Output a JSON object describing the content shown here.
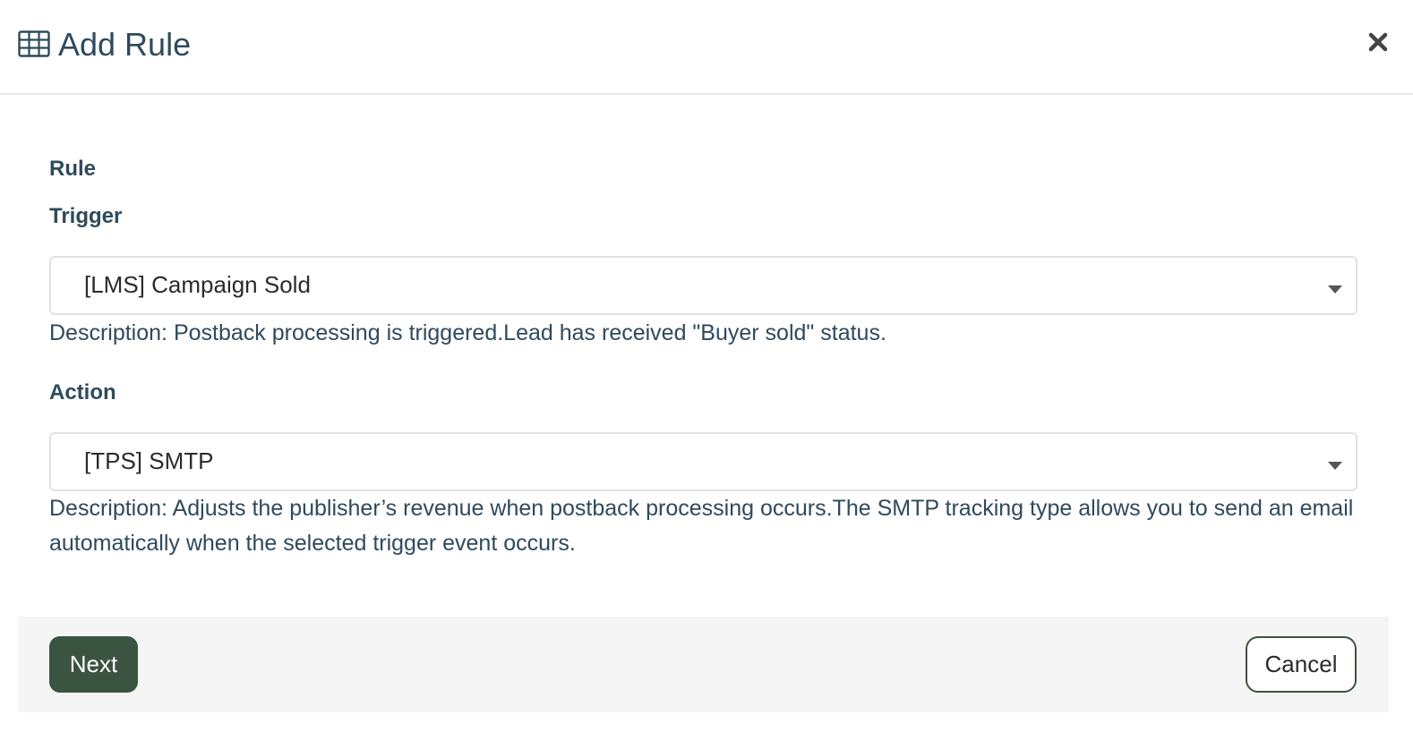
{
  "header": {
    "icon": "table-icon",
    "title": "Add Rule",
    "close_icon": "close-icon"
  },
  "form": {
    "section_label": "Rule",
    "trigger": {
      "label": "Trigger",
      "selected": "[LMS] Campaign Sold",
      "description": "Description: Postback processing is triggered.Lead has received \"Buyer sold\" status."
    },
    "action": {
      "label": "Action",
      "selected": "[TPS] SMTP",
      "description": "Description: Adjusts the publisher’s revenue when postback processing occurs.The SMTP tracking type allows you to send an email automatically when the selected trigger event occurs."
    }
  },
  "footer": {
    "next_label": "Next",
    "cancel_label": "Cancel"
  },
  "colors": {
    "primary": "#3b5441",
    "text": "#2f4a5c",
    "footer_bg": "#f5f5f5",
    "border": "#dde2e6"
  }
}
